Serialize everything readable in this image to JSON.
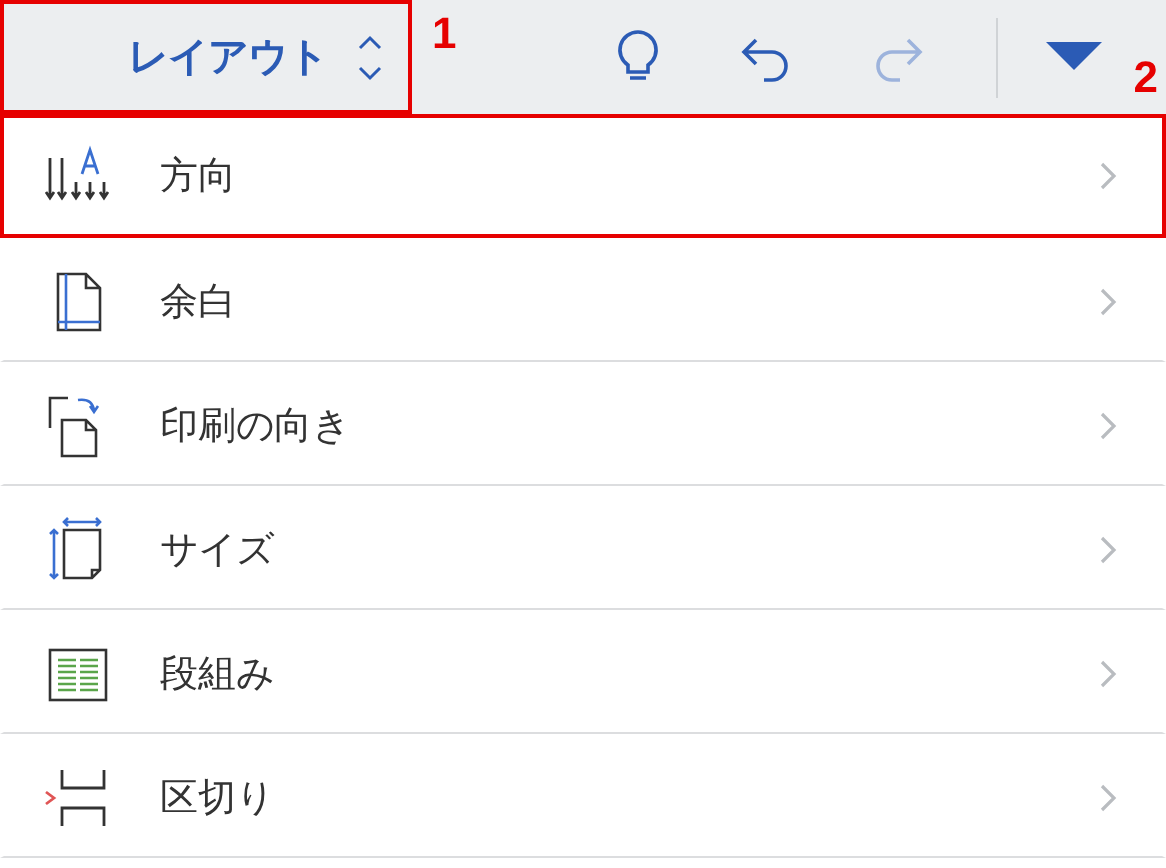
{
  "toolbar": {
    "tab_selector": {
      "label": "レイアウト",
      "highlighted": true
    },
    "callout": "1",
    "redo_disabled": true,
    "callout_2": "2"
  },
  "menu": [
    {
      "kind": "direction",
      "label": "方向",
      "highlighted": true
    },
    {
      "kind": "margins",
      "label": "余白",
      "highlighted": false
    },
    {
      "kind": "orientation",
      "label": "印刷の向き",
      "highlighted": false
    },
    {
      "kind": "size",
      "label": "サイズ",
      "highlighted": false
    },
    {
      "kind": "columns",
      "label": "段組み",
      "highlighted": false
    },
    {
      "kind": "breaks",
      "label": "区切り",
      "highlighted": false
    }
  ]
}
